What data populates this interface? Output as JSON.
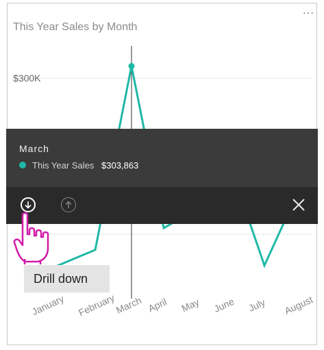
{
  "visual": {
    "title": "This Year Sales by Month",
    "more_options": "···"
  },
  "chart_data": {
    "type": "line",
    "title": "This Year Sales by Month",
    "categories": [
      "January",
      "February",
      "March",
      "April",
      "May",
      "June",
      "July",
      "August"
    ],
    "series": [
      {
        "name": "This Year Sales",
        "values": [
          238000,
          245000,
          303863,
          252000,
          258000,
          272000,
          240000,
          265000
        ]
      }
    ],
    "y_tick_labels": [
      "$300K"
    ],
    "highlighted_category": "March",
    "grid": true,
    "colors": {
      "line": "#1fb8a7"
    }
  },
  "tooltip": {
    "month": "March",
    "series_name": "This Year Sales",
    "value": "$303,863",
    "series_color": "#1fb8a7"
  },
  "actions": {
    "drill_down_icon": "arrow-down-circle-icon",
    "drill_up_icon": "arrow-up-circle-icon",
    "close_icon": "close-icon"
  },
  "callout": {
    "label": "Drill down",
    "pointer_icon": "hand-pointer-icon"
  }
}
